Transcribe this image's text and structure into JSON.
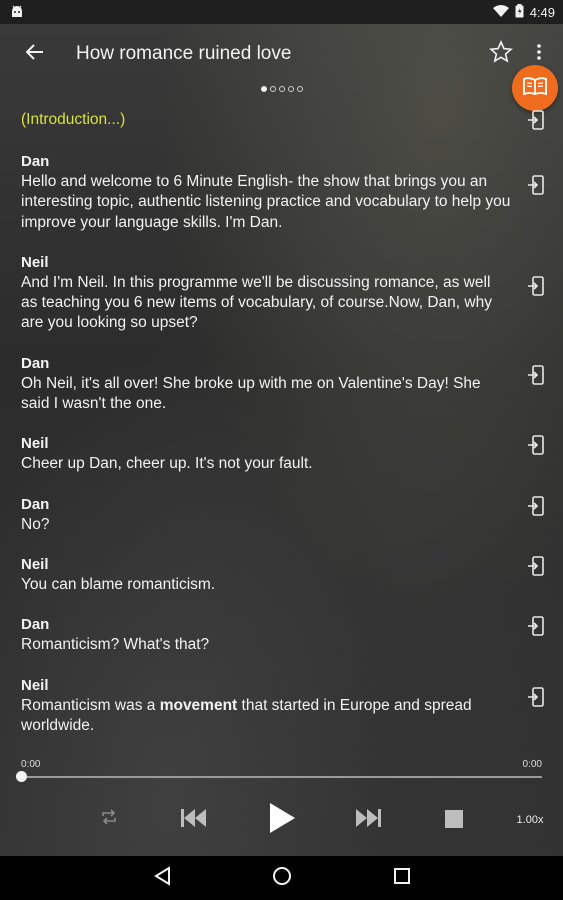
{
  "status_bar": {
    "time": "4:49"
  },
  "app_bar": {
    "title": "How romance ruined love"
  },
  "pager": {
    "dots": 5,
    "active": 0
  },
  "transcript": {
    "intro": "(Introduction...)",
    "lines": [
      {
        "speaker": "Dan",
        "text": "Hello and welcome to 6 Minute English- the show that brings you an interesting topic, authentic listening practice and vocabulary to help you improve your language skills. I'm Dan."
      },
      {
        "speaker": "Neil",
        "text": "And I'm Neil. In this programme we'll be discussing romance, as well as teaching you 6 new items of vocabulary, of course.Now, Dan, why are you looking so upset?"
      },
      {
        "speaker": "Dan",
        "text": "Oh Neil, it's all over! She broke up with me on Valentine's Day! She said I wasn't the one."
      },
      {
        "speaker": "Neil",
        "text": "Cheer up Dan, cheer up. It's not your fault."
      },
      {
        "speaker": "Dan",
        "text": "No?"
      },
      {
        "speaker": "Neil",
        "text": "You can blame romanticism."
      },
      {
        "speaker": "Dan",
        "text": "Romanticism? What's that?"
      },
      {
        "speaker": "Neil",
        "text_before": "Romanticism was a ",
        "text_bold": "movement",
        "text_after": " that started in Europe and spread worldwide."
      }
    ]
  },
  "player": {
    "elapsed": "0:00",
    "duration": "0:00",
    "progress": 0,
    "speed": "1.00x"
  },
  "colors": {
    "accent": "#ef6c1f",
    "intro": "#d6e23a"
  },
  "icons": {
    "status_left": "android-icon",
    "wifi": "wifi-icon",
    "battery": "battery-icon",
    "back": "arrow-back-icon",
    "star": "star-outline-icon",
    "menu": "more-vert-icon",
    "fab": "open-book-icon",
    "line_action": "phone-enter-icon",
    "repeat": "repeat-icon",
    "prev": "skip-previous-icon",
    "play": "play-icon",
    "next": "skip-next-icon",
    "stop": "stop-icon"
  }
}
